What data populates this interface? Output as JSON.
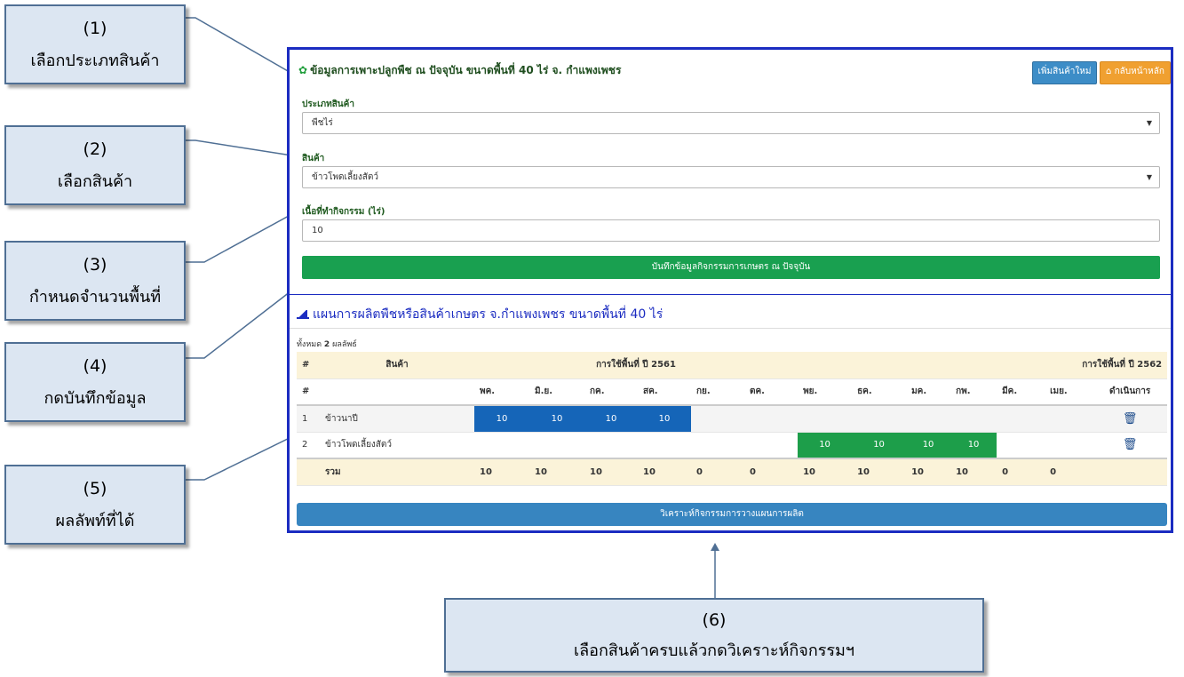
{
  "callouts": [
    {
      "num": "(1)",
      "text": "เลือกประเภทสินค้า"
    },
    {
      "num": "(2)",
      "text": "เลือกสินค้า"
    },
    {
      "num": "(3)",
      "text": "กำหนดจำนวนพื้นที่"
    },
    {
      "num": "(4)",
      "text": "กดบันทึกข้อมูล"
    },
    {
      "num": "(5)",
      "text": "ผลลัพท์ที่ได้"
    },
    {
      "num": "(6)",
      "text": "เลือกสินค้าครบแล้วกดวิเคราะห์กิจกรรมฯ"
    }
  ],
  "form": {
    "title": "ข้อมูลการเพาะปลูกพืช ณ ปัจจุบัน ขนาดพื้นที่ 40 ไร่ จ. กำแพงเพชร",
    "btn_new": "เพิ่มสินค้าใหม่",
    "btn_home": "กลับหน้าหลัก",
    "category_label": "ประเภทสินค้า",
    "category_value": "พืชไร่",
    "product_label": "สินค้า",
    "product_value": "ข้าวโพดเลี้ยงสัตว์",
    "area_label": "เนื้อที่ทำกิจกรรม (ไร่)",
    "area_value": "10",
    "save_label": "บันทึกข้อมูลกิจกรรมการเกษตร ณ ปัจจุบัน"
  },
  "plan": {
    "title": "แผนการผลิตพืชหรือสินค้าเกษตร จ.กำแพงเพชร ขนาดพื้นที่ 40 ไร่",
    "count_prefix": "ทั้งหมด",
    "count_value": "2",
    "count_suffix": "ผลลัพธ์",
    "col_hash": "#",
    "col_product": "สินค้า",
    "year1": "การใช้พื้นที่ ปี 2561",
    "year2": "การใช้พื้นที่ ปี 2562",
    "months": [
      "พค.",
      "มิ.ย.",
      "กค.",
      "สค.",
      "กย.",
      "ตค.",
      "พย.",
      "ธค.",
      "มค.",
      "กพ.",
      "มีค.",
      "เมย."
    ],
    "action_col": "ดำเนินการ",
    "rows": [
      {
        "idx": "1",
        "name": "ข้าวนาปี"
      },
      {
        "idx": "2",
        "name": "ข้าวโพดเลี้ยงสัตว์"
      }
    ],
    "cell_value": "10",
    "sum_label": "รวม",
    "sums": [
      "10",
      "10",
      "10",
      "10",
      "0",
      "0",
      "10",
      "10",
      "10",
      "10",
      "0",
      "0"
    ],
    "analyze_label": "วิเคราะห์กิจกรรมการวางแผนการผลิต"
  }
}
